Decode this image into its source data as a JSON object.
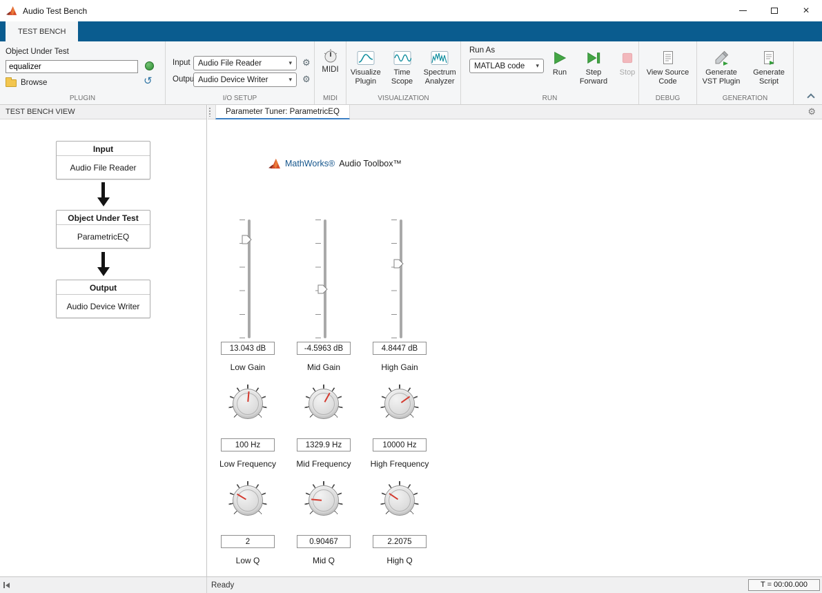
{
  "window": {
    "title": "Audio Test Bench"
  },
  "ribbon": {
    "tab": "TEST BENCH",
    "plugin": {
      "section": "PLUGIN",
      "object_under_test": "Object Under Test",
      "name": "equalizer",
      "browse": "Browse"
    },
    "io": {
      "section": "I/O SETUP",
      "input": "Input",
      "input_value": "Audio File Reader",
      "output": "Output",
      "output_value": "Audio Device Writer"
    },
    "midi": {
      "section": "MIDI",
      "button": "MIDI"
    },
    "visualization": {
      "section": "VISUALIZATION",
      "visualize_plugin": "Visualize Plugin",
      "time_scope": "Time Scope",
      "spectrum_analyzer": "Spectrum Analyzer"
    },
    "run": {
      "section": "RUN",
      "run_as": "Run As",
      "run_as_value": "MATLAB code",
      "run": "Run",
      "step_forward": "Step Forward",
      "stop": "Stop"
    },
    "debug": {
      "section": "DEBUG",
      "view_source": "View Source Code"
    },
    "generation": {
      "section": "GENERATION",
      "vst": "Generate VST Plugin",
      "script": "Generate Script"
    }
  },
  "left_panel": {
    "header": "TEST BENCH VIEW",
    "blocks": [
      {
        "title": "Input",
        "value": "Audio File Reader"
      },
      {
        "title": "Object Under Test",
        "value": "ParametricEQ"
      },
      {
        "title": "Output",
        "value": "Audio Device Writer"
      }
    ]
  },
  "tuner": {
    "tab_title": "Parameter Tuner: ParametricEQ",
    "brand": {
      "mathworks": "MathWorks®",
      "product": "Audio Toolbox™"
    },
    "sliders": [
      {
        "value": "13.043 dB",
        "label": "Low Gain",
        "thumb_top": "17%"
      },
      {
        "value": "-4.5963 dB",
        "label": "Mid Gain",
        "thumb_top": "59%"
      },
      {
        "value": "4.8447 dB",
        "label": "High Gain",
        "thumb_top": "37%"
      }
    ],
    "freq_knobs": [
      {
        "value": "100 Hz",
        "label": "Low Frequency",
        "needle": "5deg"
      },
      {
        "value": "1329.9 Hz",
        "label": "Mid Frequency",
        "needle": "29deg"
      },
      {
        "value": "10000 Hz",
        "label": "High Frequency",
        "needle": "54deg"
      }
    ],
    "q_knobs": [
      {
        "value": "2",
        "label": "Low Q",
        "needle": "-59deg"
      },
      {
        "value": "0.90467",
        "label": "Mid Q",
        "needle": "-85deg"
      },
      {
        "value": "2.2075",
        "label": "High Q",
        "needle": "-56deg"
      }
    ]
  },
  "status": {
    "ready": "Ready",
    "timer": "T = 00:00.000"
  },
  "icons": {
    "gear": "⚙",
    "chevron_down": "▾",
    "reload": "↺",
    "close": "×"
  }
}
